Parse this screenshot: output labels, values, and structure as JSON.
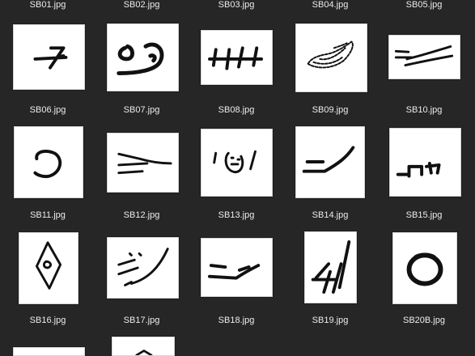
{
  "files": [
    {
      "name": "SB01.jpg"
    },
    {
      "name": "SB02.jpg"
    },
    {
      "name": "SB03.jpg"
    },
    {
      "name": "SB04.jpg"
    },
    {
      "name": "SB05.jpg"
    },
    {
      "name": "SB06.jpg"
    },
    {
      "name": "SB07.jpg"
    },
    {
      "name": "SB08.jpg"
    },
    {
      "name": "SB09.jpg"
    },
    {
      "name": "SB10.jpg"
    },
    {
      "name": "SB11.jpg"
    },
    {
      "name": "SB12.jpg"
    },
    {
      "name": "SB13.jpg"
    },
    {
      "name": "SB14.jpg"
    },
    {
      "name": "SB15.jpg"
    },
    {
      "name": "SB16.jpg"
    },
    {
      "name": "SB17.jpg"
    },
    {
      "name": "SB18.jpg"
    },
    {
      "name": "SB19.jpg"
    },
    {
      "name": "SB20B.jpg"
    }
  ]
}
